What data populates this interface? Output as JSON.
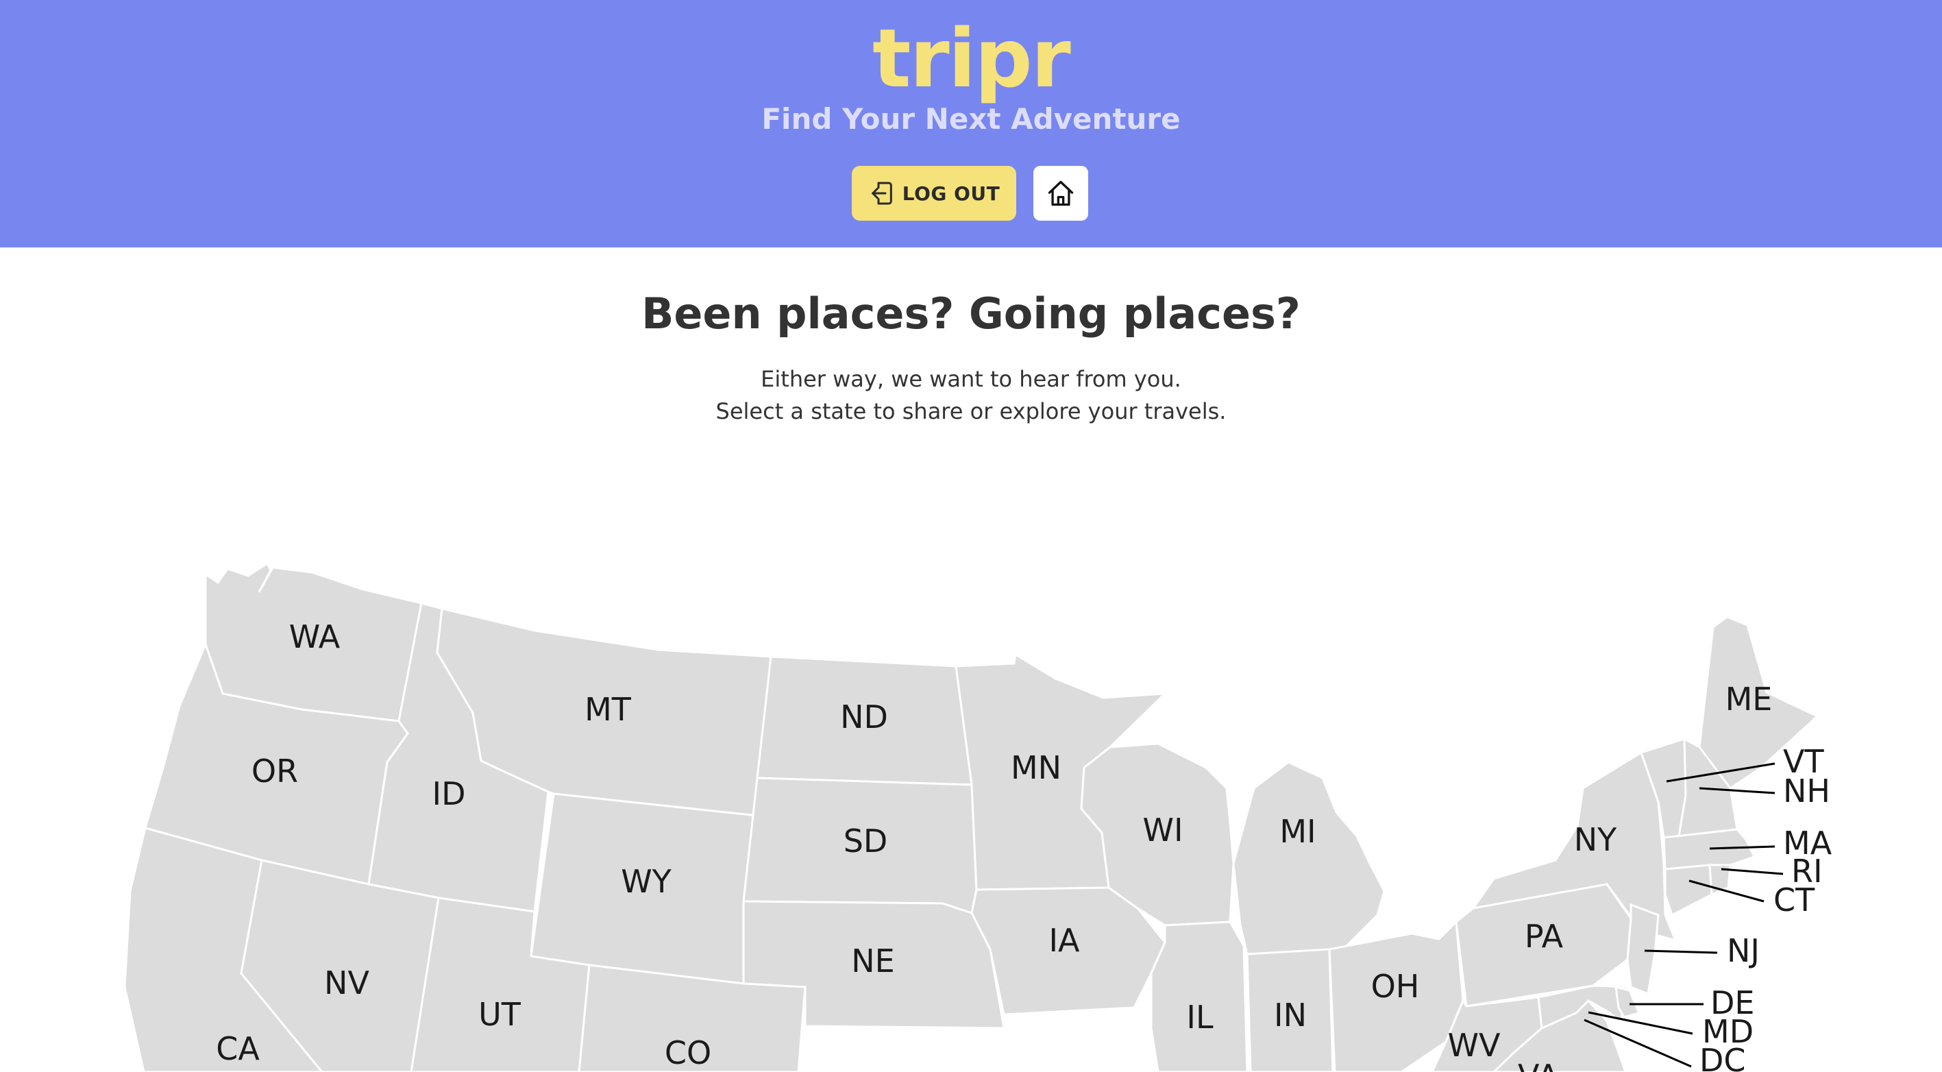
{
  "header": {
    "logo": "tripr",
    "tagline": "Find Your Next Adventure",
    "logout_label": "LOG OUT",
    "logout_icon": "logout-icon",
    "home_icon": "home-icon",
    "background_color": "#7886F0",
    "accent_color": "#F5E27A"
  },
  "main": {
    "heading": "Been places? Going places?",
    "subtitle_line1": "Either way, we want to hear from you.",
    "subtitle_line2": "Select a state to share or explore your travels."
  },
  "map": {
    "state_fill": "#DCDCDC",
    "states": {
      "wa": "WA",
      "or": "OR",
      "ca": "CA",
      "id": "ID",
      "nv": "NV",
      "mt": "MT",
      "wy": "WY",
      "ut": "UT",
      "co": "CO",
      "nd": "ND",
      "sd": "SD",
      "ne": "NE",
      "mn": "MN",
      "ia": "IA",
      "wi": "WI",
      "il": "IL",
      "mi": "MI",
      "in": "IN",
      "oh": "OH",
      "pa": "PA",
      "ny": "NY",
      "me": "ME",
      "wv": "WV",
      "va": "VA"
    },
    "callouts": {
      "vt": "VT",
      "nh": "NH",
      "ma": "MA",
      "ri": "RI",
      "ct": "CT",
      "nj": "NJ",
      "de": "DE",
      "md": "MD",
      "dc": "DC"
    }
  }
}
